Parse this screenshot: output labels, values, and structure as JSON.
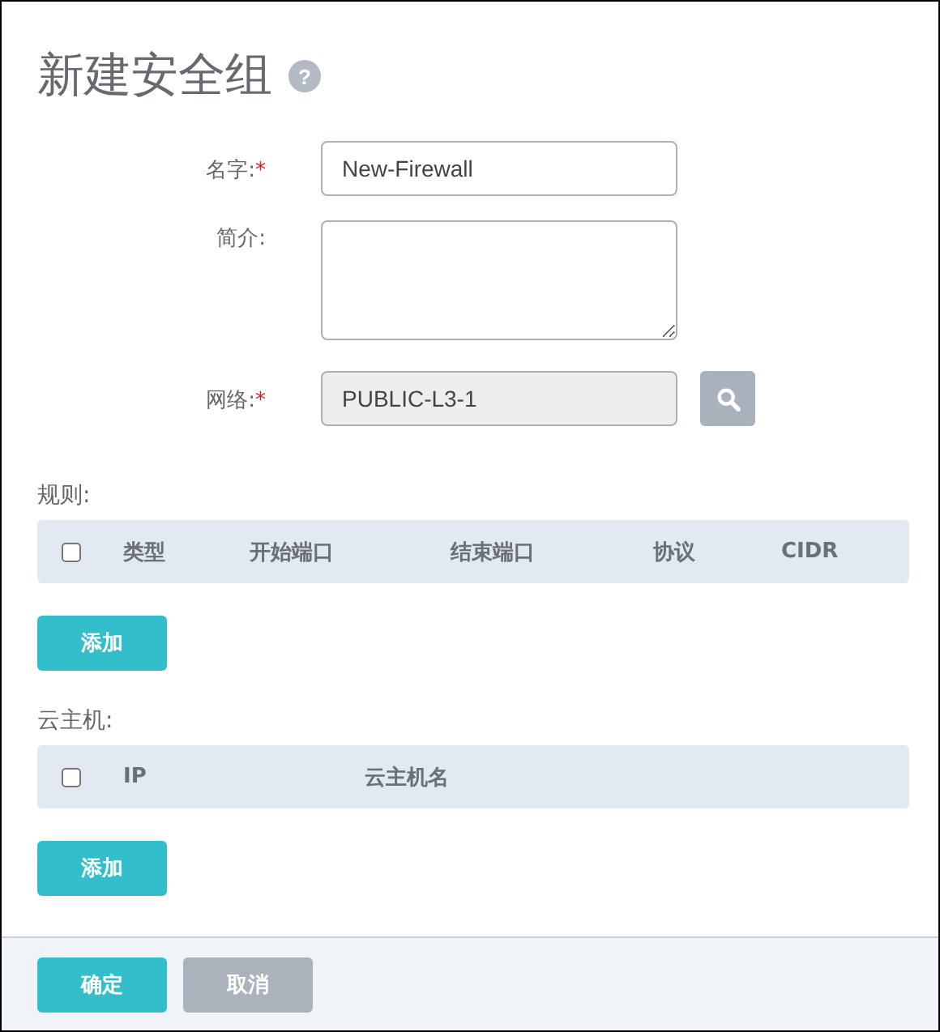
{
  "title": "新建安全组",
  "help_icon": "?",
  "fields": [
    {
      "kind": "input",
      "label": "名字:",
      "required_mark": "*",
      "value": "New-Firewall"
    },
    {
      "kind": "textarea",
      "label": "简介:"
    },
    {
      "kind": "lookup",
      "label": "网络:",
      "required_mark": "*",
      "value": "PUBLIC-L3-1",
      "disabled": true
    }
  ],
  "sections": [
    {
      "label": "规则:",
      "checked": false,
      "columns": [
        "类型",
        "开始端口",
        "结束端口",
        "协议",
        "CIDR"
      ],
      "add_button": "添加"
    },
    {
      "label": "云主机:",
      "checked": false,
      "columns": [
        "IP",
        "云主机名"
      ],
      "add_button": "添加"
    }
  ],
  "footer": {
    "buttons": [
      {
        "label": "确定",
        "kind": "primary"
      },
      {
        "label": "取消",
        "kind": "secondary"
      }
    ]
  }
}
